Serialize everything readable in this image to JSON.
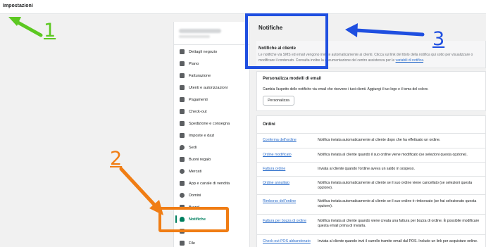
{
  "header": {
    "title": "Impostazioni"
  },
  "sidebar": {
    "items": [
      {
        "label": "Dettagli negozio",
        "icon": "store-icon"
      },
      {
        "label": "Piano",
        "icon": "plan-icon"
      },
      {
        "label": "Fatturazione",
        "icon": "billing-icon"
      },
      {
        "label": "Utenti e autorizzazioni",
        "icon": "users-icon"
      },
      {
        "label": "Pagamenti",
        "icon": "payments-icon"
      },
      {
        "label": "Check-out",
        "icon": "cart-icon"
      },
      {
        "label": "Spedizione e consegna",
        "icon": "truck-icon"
      },
      {
        "label": "Imposte e dazi",
        "icon": "tax-icon"
      },
      {
        "label": "Sedi",
        "icon": "location-icon"
      },
      {
        "label": "Buoni regalo",
        "icon": "gift-card-icon"
      },
      {
        "label": "Mercati",
        "icon": "globe-icon"
      },
      {
        "label": "App e canale di vendita",
        "icon": "apps-icon"
      },
      {
        "label": "Domini",
        "icon": "domain-icon"
      },
      {
        "label": "Brand",
        "icon": "brand-icon"
      },
      {
        "label": "Notifiche",
        "icon": "bell-icon"
      },
      {
        "label": "Metafield",
        "icon": "metafield-icon"
      },
      {
        "label": "File",
        "icon": "paperclip-icon"
      }
    ],
    "active": "Notifiche"
  },
  "main": {
    "title": "Notifiche",
    "customer_notifications": {
      "title": "Notifiche al cliente",
      "description_a": "Le notifiche via SMS ed email vengono inviate automaticamente ai clienti. Clicca sul link del titolo della notifica qui sotto per visualizzare o modificare il contenuto. Consulta inoltre la documentazione del centro assistenza per le ",
      "description_link": "variabili di notifica",
      "description_b": "."
    },
    "email_templates": {
      "title": "Personalizza modelli di email",
      "description": "Cambia l'aspetto delle notifiche via email che ricevono i tuoi clienti. Aggiungi il tuo logo e il tema del colore.",
      "button": "Personalizza"
    },
    "orders": {
      "title": "Ordini",
      "rows": [
        {
          "name": "Conferma dell'ordine",
          "desc": "Notifica inviata automaticamente al cliente dopo che ha effettuato un ordine."
        },
        {
          "name": "Ordine modificato",
          "desc": "Notifica inviata al cliente quando il suo ordine viene modificato (se selezioni questa opzione)."
        },
        {
          "name": "Fattura ordine",
          "desc": "Inviata al cliente quando l'ordine aveva un saldo in sospeso."
        },
        {
          "name": "Ordine annullato",
          "desc": "Notifica inviata automaticamente al cliente se il suo ordine viene cancellato (se selezioni questa opzione)."
        },
        {
          "name": "Rimborso dell'ordine",
          "desc": "Notifica inviata automaticamente al cliente se il suo ordine è rimborsato (se hai selezionato questa opzione)."
        },
        {
          "name": "Fattura per bozza di ordine",
          "desc": "Notifica inviata al cliente quando viene creata una fattura per bozza di ordine. È possibile modificare questa email prima di inviarla."
        },
        {
          "name": "Check-out POS abbandonato",
          "desc": "Inviata al cliente quando invii il carrello tramite email dal POS. Include un link per acquistare online."
        }
      ]
    }
  },
  "annotations": {
    "one": "1",
    "two": "2",
    "three": "3"
  },
  "colors": {
    "accent": "#007f5f",
    "link": "#2c6ecb",
    "annotation_blue": "#1f4fe0",
    "annotation_orange": "#f07d14",
    "annotation_green": "#5cc821"
  }
}
